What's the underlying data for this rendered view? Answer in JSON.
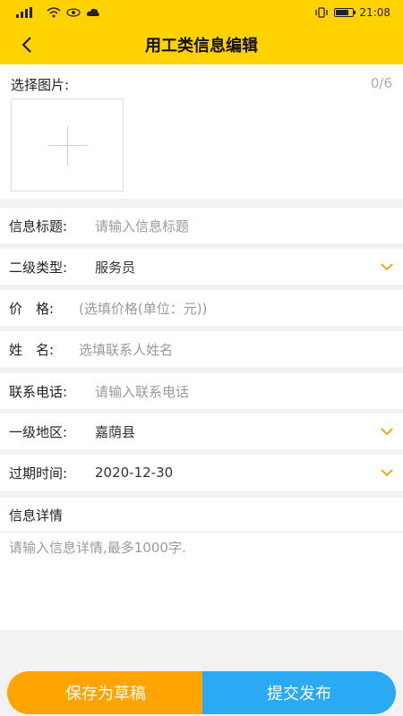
{
  "status_bar": {
    "time": "21:08"
  },
  "header": {
    "title": "用工类信息编辑"
  },
  "photos": {
    "label": "选择图片:",
    "count": "0/6"
  },
  "fields": [
    {
      "label": "信息标题:",
      "placeholder": "请输入信息标题"
    },
    {
      "label": "二级类型:",
      "value": "服务员"
    },
    {
      "label": "价　格:",
      "placeholder": "(选填价格(单位：元))"
    },
    {
      "label": "姓　名:",
      "placeholder": "选填联系人姓名"
    },
    {
      "label": "联系电话:",
      "placeholder": "请输入联系电话"
    },
    {
      "label": "一级地区:",
      "value": "嘉荫县"
    },
    {
      "label": "过期时间:",
      "value": "2020-12-30"
    }
  ],
  "detail": {
    "label": "信息详情",
    "placeholder": "请输入信息详情,最多1000字."
  },
  "buttons": {
    "save": "保存为草稿",
    "submit": "提交发布"
  },
  "colors": {
    "accent": "#ffd200",
    "save": "#ffa400",
    "submit": "#29aaf3"
  }
}
